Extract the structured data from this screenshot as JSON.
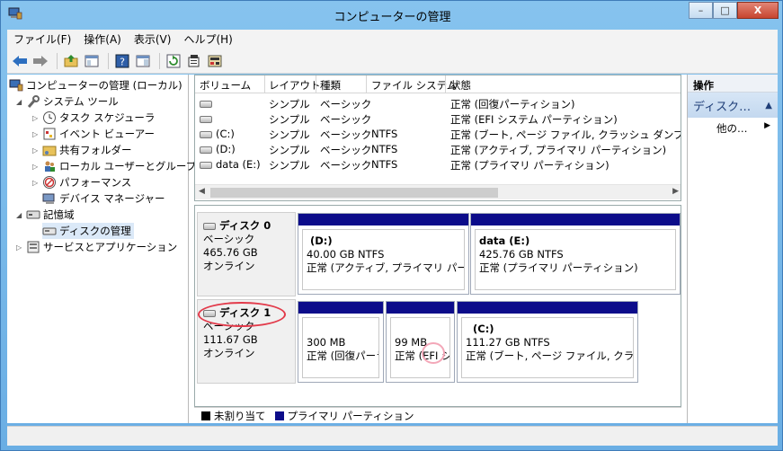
{
  "window": {
    "title": "コンピューターの管理"
  },
  "window_controls": {
    "minimize": "–",
    "maximize": "□",
    "close": "X"
  },
  "menu": [
    "ファイル(F)",
    "操作(A)",
    "表示(V)",
    "ヘルプ(H)"
  ],
  "tree": [
    {
      "label": "コンピューターの管理 (ローカル)",
      "icon": "computer-management-icon"
    },
    {
      "label": "システム ツール",
      "icon": "tools-icon"
    },
    {
      "label": "タスク スケジューラ",
      "icon": "clock-icon"
    },
    {
      "label": "イベント ビューアー",
      "icon": "event-viewer-icon"
    },
    {
      "label": "共有フォルダー",
      "icon": "shared-folder-icon"
    },
    {
      "label": "ローカル ユーザーとグループ",
      "icon": "users-icon"
    },
    {
      "label": "パフォーマンス",
      "icon": "performance-icon"
    },
    {
      "label": "デバイス マネージャー",
      "icon": "device-manager-icon"
    },
    {
      "label": "記憶域",
      "icon": "storage-icon"
    },
    {
      "label": "ディスクの管理",
      "icon": "disk-management-icon"
    },
    {
      "label": "サービスとアプリケーション",
      "icon": "services-icon"
    }
  ],
  "volume_list": {
    "headers": [
      "ボリューム",
      "レイアウト",
      "種類",
      "ファイル システム",
      "状態"
    ],
    "rows": [
      {
        "volume": "",
        "layout": "シンプル",
        "type": "ベーシック",
        "fs": "",
        "status": "正常 (回復パーティション)"
      },
      {
        "volume": "",
        "layout": "シンプル",
        "type": "ベーシック",
        "fs": "",
        "status": "正常 (EFI システム パーティション)"
      },
      {
        "volume": "(C:)",
        "layout": "シンプル",
        "type": "ベーシック",
        "fs": "NTFS",
        "status": "正常 (ブート, ページ ファイル, クラッシュ ダンプ, プライマ"
      },
      {
        "volume": "(D:)",
        "layout": "シンプル",
        "type": "ベーシック",
        "fs": "NTFS",
        "status": "正常 (アクティブ, プライマリ パーティション)"
      },
      {
        "volume": "data (E:)",
        "layout": "シンプル",
        "type": "ベーシック",
        "fs": "NTFS",
        "status": "正常 (プライマリ パーティション)"
      }
    ]
  },
  "disks": [
    {
      "name": "ディスク 0",
      "type": "ベーシック",
      "size": "465.76 GB",
      "state": "オンライン",
      "partitions": [
        {
          "name": "(D:)",
          "size": "40.00 GB NTFS",
          "status": "正常 (アクティブ, プライマリ パーティシ"
        },
        {
          "name": "data  (E:)",
          "size": "425.76 GB NTFS",
          "status": "正常 (プライマリ パーティション)"
        }
      ]
    },
    {
      "name": "ディスク 1",
      "type": "ベーシック",
      "size": "111.67 GB",
      "state": "オンライン",
      "partitions": [
        {
          "name": "",
          "size": "300 MB",
          "status": "正常 (回復パーラ"
        },
        {
          "name": "",
          "size": "99 MB",
          "status": "正常 (EFI シ"
        },
        {
          "name": "(C:)",
          "size": "111.27 GB NTFS",
          "status": "正常 (ブート, ページ ファイル, クラッシュ"
        }
      ]
    }
  ],
  "legend": [
    {
      "label": "未割り当て",
      "color": "#000000"
    },
    {
      "label": "プライマリ パーティション",
      "color": "#0c0c8a"
    }
  ],
  "actions": {
    "header": "操作",
    "section": "ディスク…",
    "more": "他の…"
  }
}
